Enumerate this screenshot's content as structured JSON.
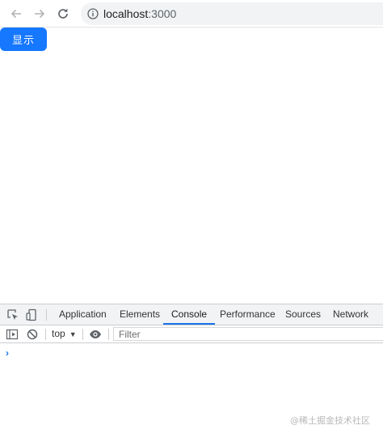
{
  "browser": {
    "url_host": "localhost",
    "url_port": ":3000"
  },
  "page": {
    "show_button_label": "显示"
  },
  "devtools": {
    "tabs": [
      "Application",
      "Elements",
      "Console",
      "Performance",
      "Sources",
      "Network"
    ],
    "active_tab": "Console",
    "context": "top",
    "filter_placeholder": "Filter",
    "prompt": "›"
  },
  "watermark": "@稀土掘金技术社区",
  "colors": {
    "primary_button": "#1677ff",
    "active_tab_underline": "#1a73e8"
  }
}
